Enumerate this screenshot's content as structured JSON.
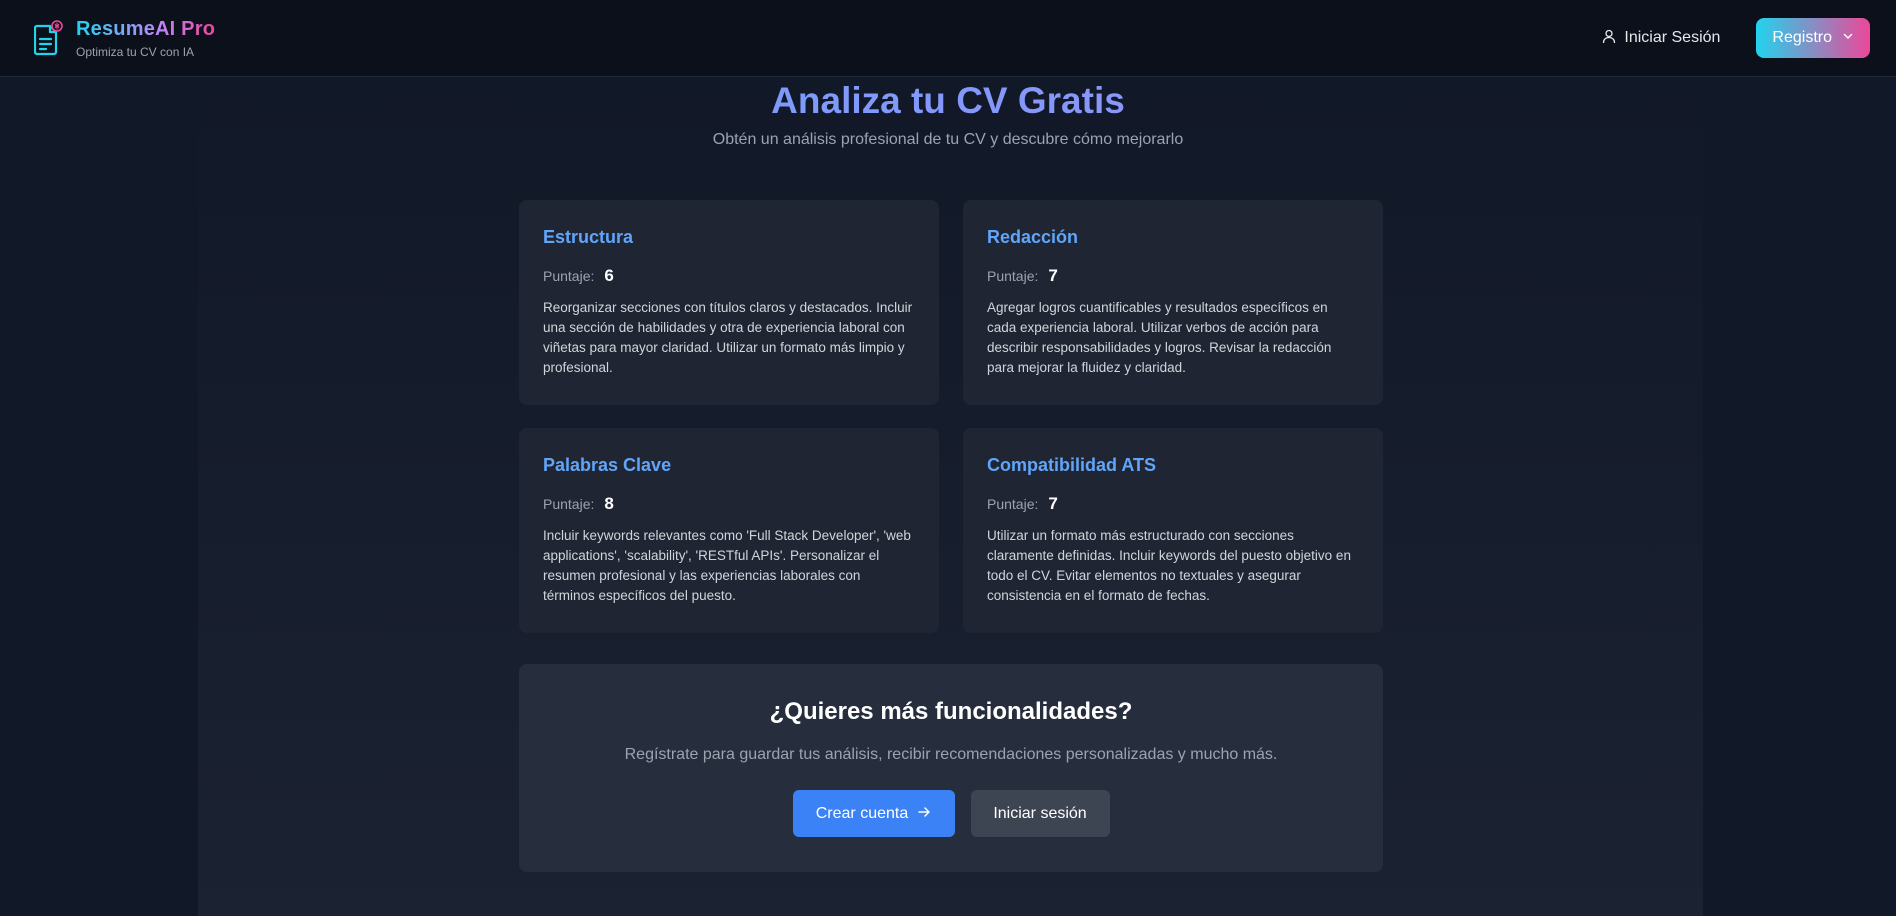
{
  "header": {
    "brand_title": "ResumeAI Pro",
    "brand_subtitle": "Optimiza tu CV con IA",
    "login_label": "Iniciar Sesión",
    "register_label": "Registro"
  },
  "hero": {
    "title": "Analiza tu CV Gratis",
    "subtitle": "Obtén un análisis profesional de tu CV y descubre cómo mejorarlo"
  },
  "score_label": "Puntaje:",
  "cards": [
    {
      "title": "Estructura",
      "score": "6",
      "description": "Reorganizar secciones con títulos claros y destacados. Incluir una sección de habilidades y otra de experiencia laboral con viñetas para mayor claridad. Utilizar un formato más limpio y profesional."
    },
    {
      "title": "Redacción",
      "score": "7",
      "description": "Agregar logros cuantificables y resultados específicos en cada experiencia laboral. Utilizar verbos de acción para describir responsabilidades y logros. Revisar la redacción para mejorar la fluidez y claridad."
    },
    {
      "title": "Palabras Clave",
      "score": "8",
      "description": "Incluir keywords relevantes como 'Full Stack Developer', 'web applications', 'scalability', 'RESTful APIs'. Personalizar el resumen profesional y las experiencias laborales con términos específicos del puesto."
    },
    {
      "title": "Compatibilidad ATS",
      "score": "7",
      "description": "Utilizar un formato más estructurado con secciones claramente definidas. Incluir keywords del puesto objetivo en todo el CV. Evitar elementos no textuales y asegurar consistencia en el formato de fechas."
    }
  ],
  "cta": {
    "title": "¿Quieres más funcionalidades?",
    "description": "Regístrate para guardar tus análisis, recibir recomendaciones personalizadas y mucho más.",
    "primary_label": "Crear cuenta",
    "secondary_label": "Iniciar sesión"
  },
  "colors": {
    "accent": "#60a5fa",
    "primary_button": "#3b82f6",
    "background": "#111827"
  },
  "icons": [
    "document-ai-icon",
    "user-icon",
    "chevron-down-icon",
    "arrow-right-icon"
  ]
}
